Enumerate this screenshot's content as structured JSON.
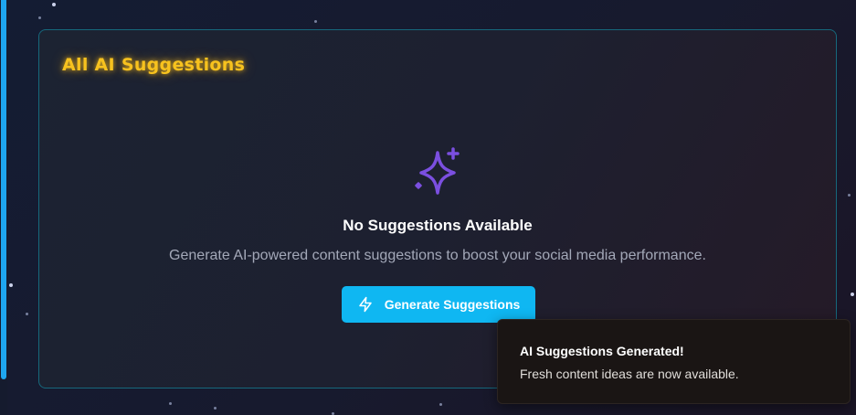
{
  "panel": {
    "title": "All AI Suggestions"
  },
  "empty_state": {
    "icon": "sparkles-icon",
    "title": "No Suggestions Available",
    "description": "Generate AI-powered content suggestions to boost your social media performance.",
    "button_label": "Generate Suggestions",
    "button_icon": "lightning-icon"
  },
  "toast": {
    "title": "AI Suggestions Generated!",
    "message": "Fresh content ideas are now available."
  },
  "colors": {
    "title_glow": "#f7c21e",
    "accent": "#0fb7f2",
    "sparkle": "#7b4fe0",
    "panel_border": "#16687c"
  }
}
